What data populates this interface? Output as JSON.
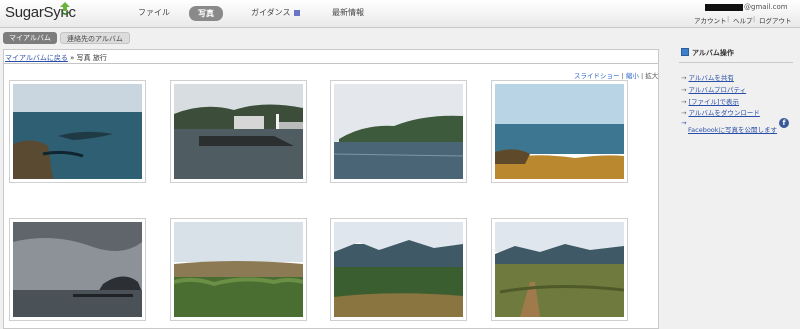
{
  "header": {
    "logo": "SugarSync",
    "nav": [
      "ファイル",
      "写真",
      "ガイダンス",
      "最新情報"
    ],
    "active_nav": "写真",
    "email_suffix": "@gmail.com",
    "links": [
      "アカウント",
      "ヘルプ",
      "ログアウト"
    ]
  },
  "subtabs": [
    "マイアルバム",
    "連絡先のアルバム"
  ],
  "breadcrumb": {
    "back_link": "マイアルバムに戻る",
    "separator": " » ",
    "path": "写真  旅行"
  },
  "view_controls": {
    "slideshow": "スライドショー",
    "shrink": "縮小",
    "divider": "|",
    "enlarge": "拡大"
  },
  "sidebar": {
    "title": "アルバム操作",
    "items": [
      "アルバムを共有",
      "アルバムプロパティ",
      "[ファイル]で表示",
      "アルバムをダウンロード",
      "Facebookに写真を公開します"
    ]
  },
  "photos": [
    {
      "icon": "coastal-rocks-photo"
    },
    {
      "icon": "harbor-lighthouse-photo"
    },
    {
      "icon": "cliff-sea-photo"
    },
    {
      "icon": "sunset-coast-photo"
    },
    {
      "icon": "cloudy-sea-island-photo"
    },
    {
      "icon": "grassland-photo"
    },
    {
      "icon": "mountain-wetland-photo"
    },
    {
      "icon": "boardwalk-photo"
    }
  ],
  "colors": {
    "link": "#2a4fa8",
    "active_tab": "#8a8a8a",
    "facebook": "#3b5998"
  }
}
